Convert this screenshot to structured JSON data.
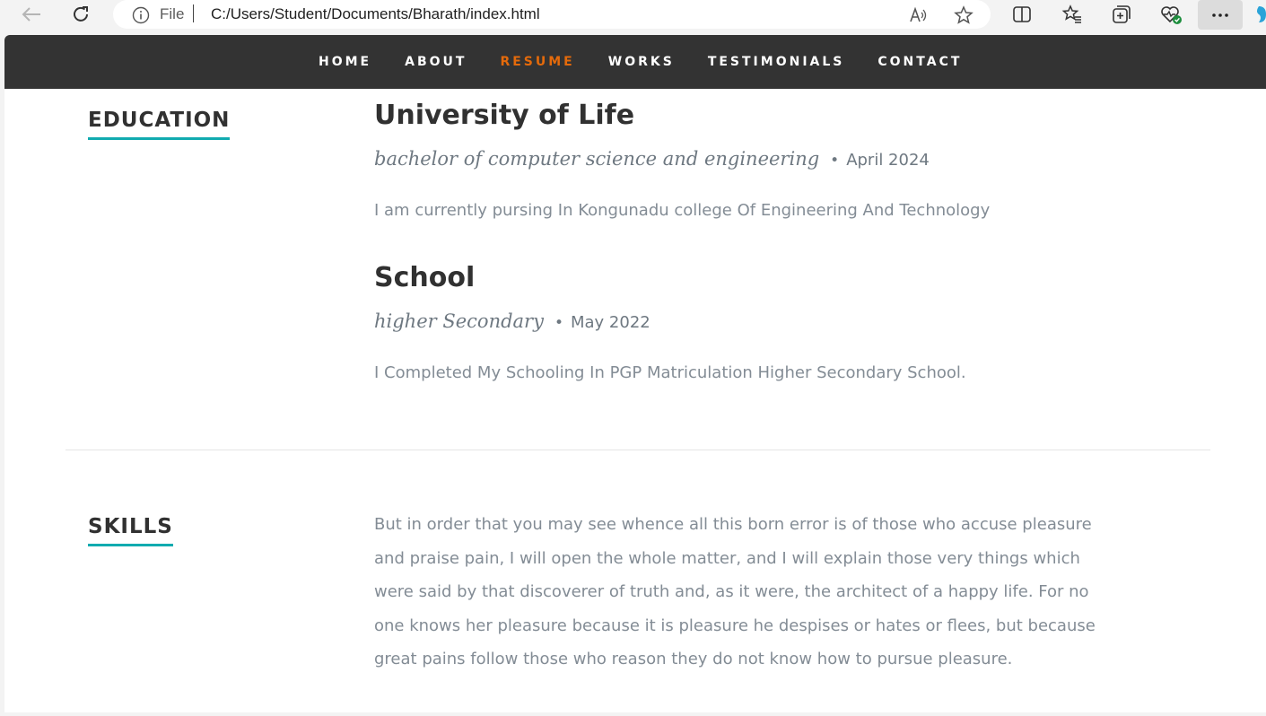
{
  "browser": {
    "address_prefix": "File",
    "url": "C:/Users/Student/Documents/Bharath/index.html",
    "icons": [
      "back-arrow-icon",
      "refresh-icon",
      "info-icon",
      "read-aloud-icon",
      "star-icon",
      "split-screen-icon",
      "favorites-icon",
      "collections-icon",
      "browser-essentials-icon",
      "more-icon"
    ]
  },
  "nav": {
    "items": [
      "HOME",
      "ABOUT",
      "RESUME",
      "WORKS",
      "TESTIMONIALS",
      "CONTACT"
    ],
    "current": "RESUME",
    "current_color": "#e46a0b"
  },
  "education": {
    "heading": "EDUCATION",
    "entries": [
      {
        "school": "University of Life",
        "degree": "bachelor of computer science and engineering",
        "bullet": "•",
        "date": "April 2024",
        "description": "I am currently pursing In Kongunadu college Of Engineering And Technology"
      },
      {
        "school": "School",
        "degree": "higher Secondary",
        "bullet": "•",
        "date": "May 2022",
        "description": "I Completed My Schooling In PGP Matriculation Higher Secondary School."
      }
    ]
  },
  "skills": {
    "heading": "SKILLS",
    "text": "But in order that you may see whence all this born error is of those who accuse pleasure and praise pain, I will open the whole matter, and I will explain those very things which were said by that discoverer of truth and, as it were, the architect of a happy life. For no one knows her pleasure because it is pleasure he despises or hates or flees, but because great pains follow those who reason they do not know how to pursue pleasure."
  },
  "colors": {
    "accent": "#11abb0",
    "nav_bg": "#333333",
    "heading": "#313131",
    "body_text": "#838c95"
  }
}
